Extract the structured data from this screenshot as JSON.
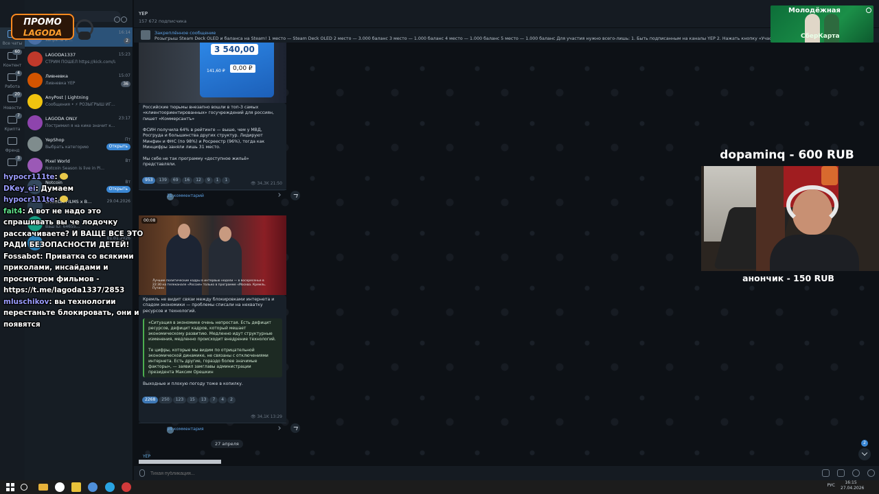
{
  "rail": {
    "items": [
      {
        "label": "Все чаты",
        "badge": "",
        "active": true
      },
      {
        "label": "Контент",
        "badge": "60"
      },
      {
        "label": "Работа",
        "badge": "4"
      },
      {
        "label": "Новости",
        "badge": "20"
      },
      {
        "label": "Крипта",
        "badge": "7"
      },
      {
        "label": "Френд",
        "badge": ""
      },
      {
        "label": "",
        "badge": "3"
      }
    ]
  },
  "promo": {
    "line1": "ПРОМО",
    "line2": "LAGODA"
  },
  "chats": [
    {
      "name": "",
      "preview": "запреты и ...",
      "time": "16:14",
      "badge": "2",
      "color": "#4a6fa5",
      "active": true
    },
    {
      "name": "LAGODA1337",
      "preview": "СТРИМ ПОШЕЛ https://kick.com/lag...",
      "time": "15:23",
      "color": "#c0392b"
    },
    {
      "name": "Ливневка",
      "preview": "Ливневка YEP",
      "time": "15:07",
      "badge": "36",
      "color": "#d35400"
    },
    {
      "name": "AnyPost | Lightning",
      "preview": "Сообщения • ⚡ РОЗЫГРЫШ ИГ...",
      "time": "",
      "color": "#f1c40f"
    },
    {
      "name": "LAGODA ONLY",
      "preview": "Постримил я на кике значит к...",
      "time": "23:17",
      "color": "#8e44ad"
    },
    {
      "name": "YepShop",
      "preview": "Выбрать категорию",
      "time": "Пт",
      "button": "Открыть",
      "color": "#7f8c8d"
    },
    {
      "name": "Pixel World",
      "preview": "Notcoin Season is live in Pi...",
      "time": "Вт",
      "color": "#9b59b6"
    },
    {
      "name": "Notcoin",
      "preview": "... we recen...",
      "time": "Вт",
      "button": "Открыть",
      "color": "#34495e"
    },
    {
      "name": "LAGODA FILMS x B...",
      "preview": "",
      "time": "29.04.2026",
      "color": "#2c3e50"
    },
    {
      "name": "",
      "preview": "Ваш ID: 64655...",
      "time": "",
      "color": "#16a085"
    },
    {
      "name": "",
      "preview": "",
      "time": "01.01.2026",
      "color": "#2980b9"
    }
  ],
  "search": {
    "placeholder": ""
  },
  "stream_chat": [
    {
      "user": "hypocr111te",
      "user_color": "#9b9dff",
      "text": ""
    },
    {
      "user": "DKey_ei",
      "user_color": "#9b9dff",
      "text": " Думаем"
    },
    {
      "user": "hypocr111te",
      "user_color": "#9b9dff",
      "text": ""
    },
    {
      "user": "fait4",
      "user_color": "#5ee08a",
      "text": " А вот не надо это спрашивать вы че лодочку расскачиваете? И ВАЩЕ ВСЕ ЭТО РАДИ БЕЗОПАСНОСТИ ДЕТЕЙ!"
    },
    {
      "user": "Fossabot",
      "user_color": "#ffffff",
      "text": " Приватка  со всякими приколами, инсайдами и просмотром фильмов - https://t.me/lagoda1337/2853"
    },
    {
      "user": "mluschikov",
      "user_color": "#9b9dff",
      "text": " вы технологии перестаньте блокировать, они и появятся"
    }
  ],
  "channel": {
    "title": "YEP",
    "subscribers": "157 672 подписчика"
  },
  "pinned": {
    "title": "Закреплённое сообщение",
    "text": "Розыгрыш Steam Deck OLED и баланса на Steam! 1 место — Steam Deck OLED 2 место — 3.000 баланс 3 место — 1.000 баланс 4 место — 1.000 баланс 5 место — 1.000 баланс Для участия нужно всего-лишь: 1. Быть подписанным на каналы YEP 2. Нажать кнопку «Участвовать» под эт"
  },
  "post1": {
    "image_amount": "3 540,00",
    "image_zero": "0,00 ₽",
    "image_small": "141,60 ₽",
    "text": "Российские тюрьмы внезапно вошли в топ-3 самых «клиентоориентированных» госучреждений для россиян, пишет «Коммерсантъ»\n\nФСИН получила 64% в рейтинге — выше, чем у МВД, Росгруда и большинства других структур. Лидируют Минфин и ФНС (по 98%) и Росреестр (96%), тогда как Минцифры заняли лишь 31 место.\n\nМы себе не так программу «доступное жильё» представляли.",
    "reactions": [
      "953",
      "139",
      "69",
      "16",
      "12",
      "9",
      "1",
      "1"
    ],
    "views": "34,3K",
    "time": "21:50",
    "comments": "31 комментарий"
  },
  "post2": {
    "video_time": "00:08",
    "caption": "Лучшие политические кадры в интервью недели — в воскресенье в 22:30 на телеканале «Россия» только в программе «Москва. Кремль. Путин»",
    "text": "Кремль не видит связи между блокировками интернета и спадом экономики — проблемы списали на нехватку ресурсов и технологий.",
    "quote": "«Ситуация в экономике очень непростая. Есть дефицит ресурсов, дефицит кадров, который мешает экономическому развитию. Медленно идут структурные изменения, медленно происходит внедрение технологий.\n\nТе цифры, которые мы видим по отрицательной экономической динамике, не связаны с отключениями интернета. Есть другие, гораздо более значимые факторы», — заявил замглавы администрации президента Максим Орешкин",
    "footer": "Выходные и плохую погоду тоже в копилку.",
    "reactions": [
      "2268",
      "250",
      "123",
      "15",
      "13",
      "7",
      "4",
      "2"
    ],
    "views": "34,1K",
    "time": "13:29",
    "comments": "94 комментария"
  },
  "date_pill": "27 апреля",
  "bottom_label": "YEP",
  "composer": {
    "placeholder": "Тихая публикация..."
  },
  "scroll_badge": "2",
  "ad": {
    "title": "Молодёжная",
    "brand": "СберКарта"
  },
  "donations": {
    "top": "dopaminq - 600 RUB",
    "bottom": "анончик - 150 RUB"
  },
  "taskbar": {
    "lang": "РУС",
    "time": "16:15",
    "date": "27.04.2026"
  }
}
